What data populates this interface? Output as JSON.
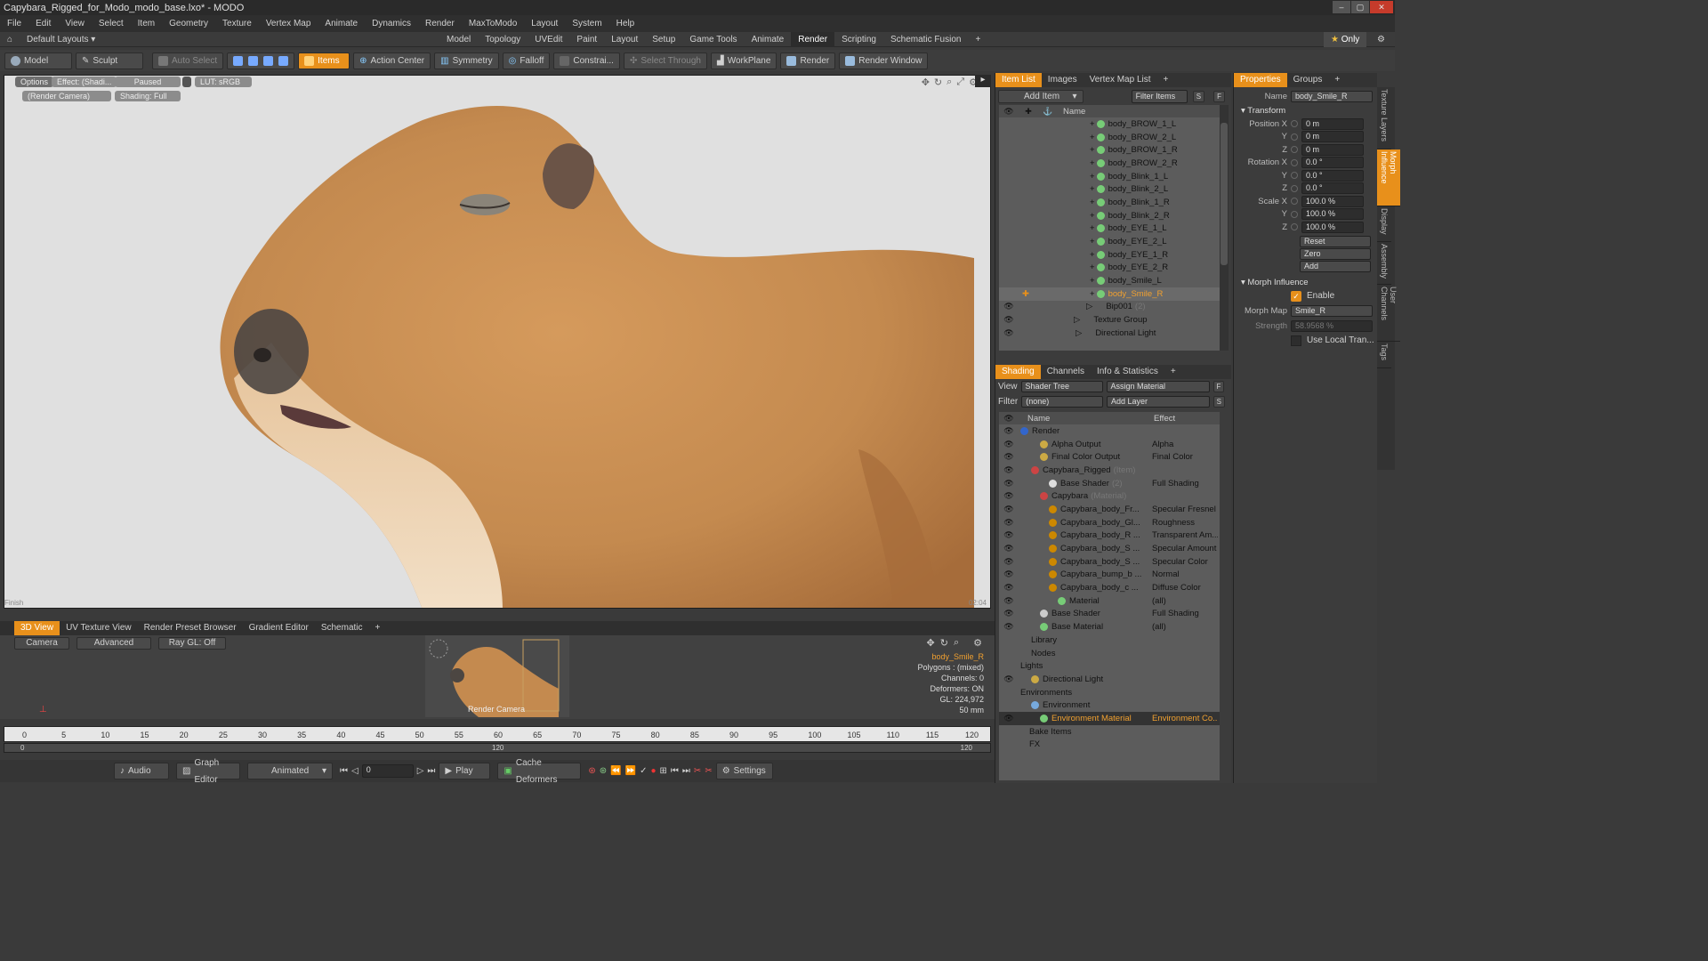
{
  "window": {
    "title": "Capybara_Rigged_for_Modo_modo_base.lxo* - MODO"
  },
  "menu": [
    "File",
    "Edit",
    "View",
    "Select",
    "Item",
    "Geometry",
    "Texture",
    "Vertex Map",
    "Animate",
    "Dynamics",
    "Render",
    "MaxToModo",
    "Layout",
    "System",
    "Help"
  ],
  "layoutbar": {
    "preset": "Default Layouts",
    "tabs": [
      "Model",
      "Topology",
      "UVEdit",
      "Paint",
      "Layout",
      "Setup",
      "Game Tools",
      "Animate",
      "Render",
      "Scripting",
      "Schematic Fusion"
    ],
    "active": "Render",
    "only": "Only"
  },
  "toolbar": {
    "model": "Model",
    "sculpt": "Sculpt",
    "auto_select": "Auto Select",
    "items": "Items",
    "action_center": "Action Center",
    "symmetry": "Symmetry",
    "falloff": "Falloff",
    "constrain": "Constrai...",
    "select_through": "Select Through",
    "workplane": "WorkPlane",
    "render": "Render",
    "render_window": "Render Window"
  },
  "viewport": {
    "options": "Options",
    "effect": "Effect: (Shadi...",
    "paused": "Paused",
    "lut": "LUT: sRGB",
    "camera": "(Render Camera)",
    "shading": "Shading: Full",
    "finish": "Finish",
    "time": "02:04",
    "colors": {
      "background": "#e0e0e0",
      "fur": "#c48a4f"
    }
  },
  "bottom_tabs": [
    "3D View",
    "UV Texture View",
    "Render Preset Browser",
    "Gradient Editor",
    "Schematic"
  ],
  "bottom_panel": {
    "camera": "Camera",
    "advanced": "Advanced",
    "raygl": "Ray GL: Off",
    "thumb_label": "Render Camera",
    "info": {
      "item": "body_Smile_R",
      "polygons": "Polygons : (mixed)",
      "channels": "Channels: 0",
      "deformers": "Deformers: ON",
      "gl": "GL: 224,972",
      "scale": "50 mm"
    }
  },
  "timeline": {
    "ticks": [
      "0",
      "5",
      "10",
      "15",
      "20",
      "25",
      "30",
      "35",
      "40",
      "45",
      "50",
      "55",
      "60",
      "65",
      "70",
      "75",
      "80",
      "85",
      "90",
      "95",
      "100",
      "105",
      "110",
      "115",
      "120"
    ],
    "sub_ticks": [
      "0",
      "120",
      "120"
    ]
  },
  "transport": {
    "audio": "Audio",
    "graph_editor": "Graph Editor",
    "mode": "Animated",
    "frame": "0",
    "play": "Play",
    "cache": "Cache Deformers",
    "settings": "Settings"
  },
  "item_list": {
    "tabs": [
      "Item List",
      "Images",
      "Vertex Map List"
    ],
    "add_item": "Add Item",
    "filter": "Filter Items",
    "col_name": "Name",
    "items": [
      {
        "name": "body_BROW_1_L",
        "sub": ""
      },
      {
        "name": "body_BROW_2_L",
        "sub": ""
      },
      {
        "name": "body_BROW_1_R",
        "sub": ""
      },
      {
        "name": "body_BROW_2_R",
        "sub": ""
      },
      {
        "name": "body_Blink_1_L",
        "sub": ""
      },
      {
        "name": "body_Blink_2_L",
        "sub": ""
      },
      {
        "name": "body_Blink_1_R",
        "sub": ""
      },
      {
        "name": "body_Blink_2_R",
        "sub": ""
      },
      {
        "name": "body_EYE_1_L",
        "sub": ""
      },
      {
        "name": "body_EYE_2_L",
        "sub": ""
      },
      {
        "name": "body_EYE_1_R",
        "sub": ""
      },
      {
        "name": "body_EYE_2_R",
        "sub": ""
      },
      {
        "name": "body_Smile_L",
        "sub": ""
      },
      {
        "name": "body_Smile_R",
        "sub": ""
      },
      {
        "name": "Bip001",
        "sub": "(2)"
      },
      {
        "name": "Texture Group",
        "sub": ""
      },
      {
        "name": "Directional Light",
        "sub": ""
      }
    ]
  },
  "shading": {
    "tabs": [
      "Shading",
      "Channels",
      "Info & Statistics"
    ],
    "view_label": "View",
    "view": "Shader Tree",
    "assign": "Assign Material",
    "filter_label": "Filter",
    "filter": "(none)",
    "add_layer": "Add Layer",
    "col_name": "Name",
    "col_effect": "Effect",
    "rows": [
      {
        "name": "Render",
        "sub": "",
        "effect": ""
      },
      {
        "name": "Alpha Output",
        "sub": "",
        "effect": "Alpha"
      },
      {
        "name": "Final Color Output",
        "sub": "",
        "effect": "Final Color"
      },
      {
        "name": "Capybara_Rigged",
        "sub": "(Item)",
        "effect": ""
      },
      {
        "name": "Base Shader",
        "sub": "(2)",
        "effect": "Full Shading"
      },
      {
        "name": "Capybara",
        "sub": "(Material)",
        "effect": ""
      },
      {
        "name": "Capybara_body_Fr...",
        "sub": "",
        "effect": "Specular Fresnel"
      },
      {
        "name": "Capybara_body_Gl...",
        "sub": "",
        "effect": "Roughness"
      },
      {
        "name": "Capybara_body_R ...",
        "sub": "",
        "effect": "Transparent Am..."
      },
      {
        "name": "Capybara_body_S ...",
        "sub": "",
        "effect": "Specular Amount"
      },
      {
        "name": "Capybara_body_S ...",
        "sub": "",
        "effect": "Specular Color"
      },
      {
        "name": "Capybara_bump_b ...",
        "sub": "",
        "effect": "Normal"
      },
      {
        "name": "Capybara_body_c ...",
        "sub": "",
        "effect": "Diffuse Color"
      },
      {
        "name": "Material",
        "sub": "",
        "effect": "(all)"
      },
      {
        "name": "Base Shader",
        "sub": "",
        "effect": "Full Shading"
      },
      {
        "name": "Base Material",
        "sub": "",
        "effect": "(all)"
      },
      {
        "name": "Library",
        "sub": "",
        "effect": ""
      },
      {
        "name": "Nodes",
        "sub": "",
        "effect": ""
      },
      {
        "name": "Lights",
        "sub": "",
        "effect": ""
      },
      {
        "name": "Directional Light",
        "sub": "",
        "effect": ""
      },
      {
        "name": "Environments",
        "sub": "",
        "effect": ""
      },
      {
        "name": "Environment",
        "sub": "",
        "effect": ""
      },
      {
        "name": "Environment Material",
        "sub": "",
        "effect": "Environment Co..."
      },
      {
        "name": "Bake Items",
        "sub": "",
        "effect": ""
      },
      {
        "name": "FX",
        "sub": "",
        "effect": ""
      }
    ]
  },
  "properties": {
    "tabs": [
      "Properties",
      "Groups"
    ],
    "name_label": "Name",
    "name": "body_Smile_R",
    "transform": "Transform",
    "pos_label": "Position X",
    "rot_label": "Rotation X",
    "scale_label": "Scale X",
    "y": "Y",
    "z": "Z",
    "pos": [
      "0 m",
      "0 m",
      "0 m"
    ],
    "rot": [
      "0.0 °",
      "0.0 °",
      "0.0 °"
    ],
    "scale": [
      "100.0 %",
      "100.0 %",
      "100.0 %"
    ],
    "reset": "Reset",
    "zero": "Zero",
    "add": "Add",
    "morph_influence": "Morph Influence",
    "enable": "Enable",
    "morph_map_label": "Morph Map",
    "morph_map": "Smile_R",
    "strength_label": "Strength",
    "strength": "58.9568 %",
    "use_local": "Use Local Tran...",
    "side_tabs": [
      "Texture Layers",
      "Morph Influence",
      "Display",
      "Assembly",
      "User Channels",
      "Tags"
    ]
  }
}
